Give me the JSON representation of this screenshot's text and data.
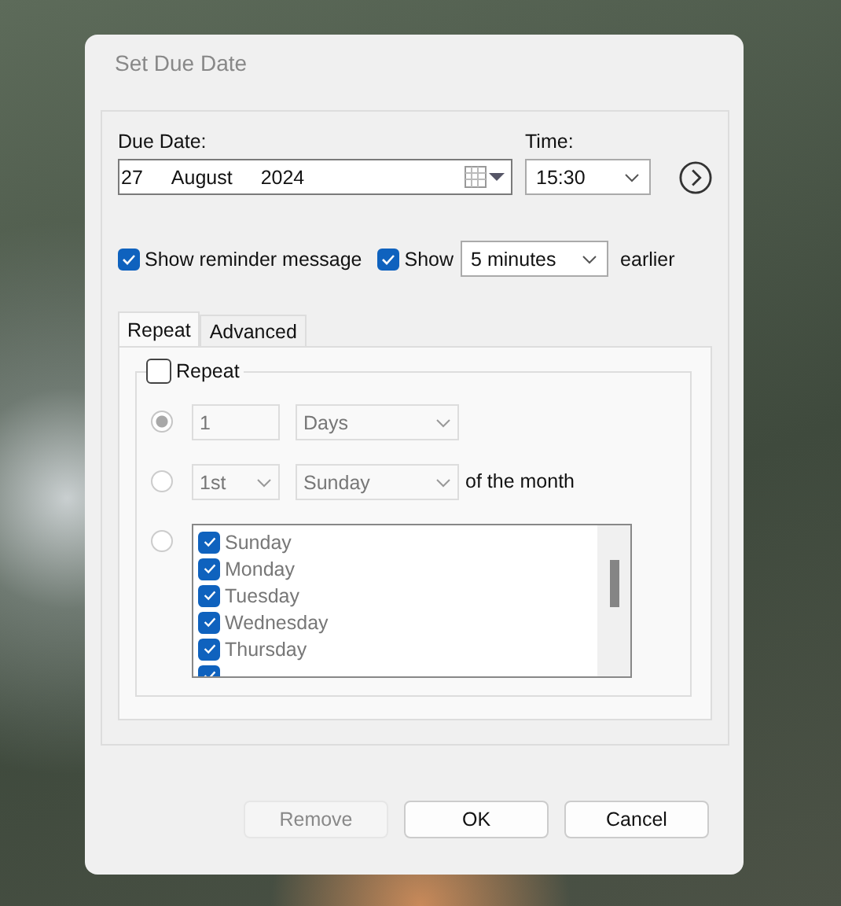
{
  "window": {
    "title": "Set Due Date"
  },
  "due_date": {
    "label": "Due Date:",
    "day": "27",
    "month": "August",
    "year": "2024"
  },
  "time": {
    "label": "Time:",
    "value": "15:30"
  },
  "reminder": {
    "checked": true,
    "label": "Show reminder message"
  },
  "show_earlier": {
    "checked": true,
    "label": "Show",
    "value": "5 minutes",
    "suffix": "earlier"
  },
  "tabs": [
    {
      "label": "Repeat",
      "selected": true
    },
    {
      "label": "Advanced",
      "selected": false
    }
  ],
  "repeat": {
    "label": "Repeat",
    "checked": false,
    "options": [
      {
        "kind": "interval",
        "selected": true,
        "number": "1",
        "unit": "Days"
      },
      {
        "kind": "monthly",
        "selected": false,
        "ordinal": "1st",
        "weekday": "Sunday",
        "suffix": "of the month"
      },
      {
        "kind": "weekdays",
        "selected": false,
        "days": [
          {
            "label": "Sunday",
            "checked": true
          },
          {
            "label": "Monday",
            "checked": true
          },
          {
            "label": "Tuesday",
            "checked": true
          },
          {
            "label": "Wednesday",
            "checked": true
          },
          {
            "label": "Thursday",
            "checked": true
          },
          {
            "checked": true
          }
        ]
      }
    ]
  },
  "buttons": [
    {
      "label": "Remove",
      "disabled": true
    },
    {
      "label": "OK",
      "disabled": false
    },
    {
      "label": "Cancel",
      "disabled": false
    }
  ]
}
